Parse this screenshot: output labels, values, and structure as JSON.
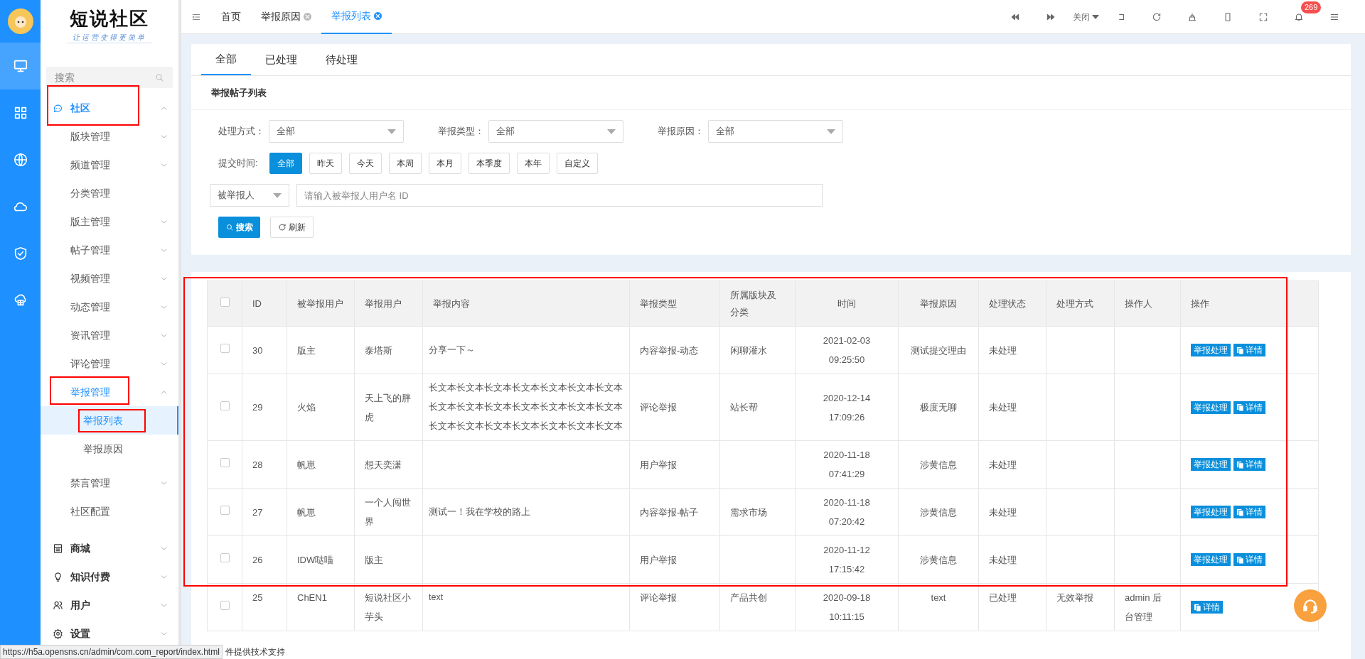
{
  "logo": {
    "title": "短说社区",
    "slogan": "让运营变得更简单"
  },
  "rail": [
    {
      "selected": true
    },
    {
      "selected": false
    },
    {
      "selected": false
    },
    {
      "selected": false
    },
    {
      "selected": false
    },
    {
      "selected": false
    }
  ],
  "sidebar": {
    "search_placeholder": "搜索",
    "items": [
      {
        "label": "社区",
        "expanded": true,
        "children": [
          {
            "label": "版块管理",
            "has_arrow": true
          },
          {
            "label": "频道管理",
            "has_arrow": true
          },
          {
            "label": "分类管理",
            "has_arrow": false
          },
          {
            "label": "版主管理",
            "has_arrow": true
          },
          {
            "label": "帖子管理",
            "has_arrow": true
          },
          {
            "label": "视频管理",
            "has_arrow": true
          },
          {
            "label": "动态管理",
            "has_arrow": true
          },
          {
            "label": "资讯管理",
            "has_arrow": true
          },
          {
            "label": "评论管理",
            "has_arrow": true
          },
          {
            "label": "举报管理",
            "has_arrow": true,
            "expanded": true,
            "children": [
              {
                "label": "举报列表",
                "selected": true
              },
              {
                "label": "举报原因",
                "selected": false
              }
            ]
          },
          {
            "label": "禁言管理",
            "has_arrow": true
          },
          {
            "label": "社区配置",
            "has_arrow": false
          }
        ]
      },
      {
        "label": "商城",
        "expanded": false
      },
      {
        "label": "知识付费",
        "expanded": false
      },
      {
        "label": "用户",
        "expanded": false
      },
      {
        "label": "设置",
        "expanded": false
      }
    ]
  },
  "tabs": [
    {
      "label": "首页",
      "closable": false,
      "selected": false
    },
    {
      "label": "举报原因",
      "closable": true,
      "selected": false
    },
    {
      "label": "举报列表",
      "closable": true,
      "selected": true
    }
  ],
  "toolbar": {
    "close_label": "关闭",
    "notification_count": "269"
  },
  "status_tabs": [
    {
      "label": "全部",
      "selected": true
    },
    {
      "label": "已处理",
      "selected": false
    },
    {
      "label": "待处理",
      "selected": false
    }
  ],
  "section_title": "举报帖子列表",
  "filters": [
    {
      "label": "处理方式：",
      "value": "全部"
    },
    {
      "label": "举报类型：",
      "value": "全部"
    },
    {
      "label": "举报原因：",
      "value": "全部"
    }
  ],
  "time_filter": {
    "label": "提交时间:",
    "options": [
      {
        "label": "全部",
        "selected": true
      },
      {
        "label": "昨天",
        "selected": false
      },
      {
        "label": "今天",
        "selected": false
      },
      {
        "label": "本周",
        "selected": false
      },
      {
        "label": "本月",
        "selected": false
      },
      {
        "label": "本季度",
        "selected": false
      },
      {
        "label": "本年",
        "selected": false
      },
      {
        "label": "自定义",
        "selected": false
      }
    ]
  },
  "user_search": {
    "type": "被举报人",
    "placeholder": "请输入被举报人用户名 ID"
  },
  "buttons": {
    "search": "搜索",
    "refresh": "刷新"
  },
  "table": {
    "all_checked": false,
    "columns": [
      "ID",
      "被举报用户",
      "举报用户",
      "举报内容",
      "举报类型",
      "所属版块及分类",
      "时间",
      "举报原因",
      "处理状态",
      "处理方式",
      "操作人",
      "操作"
    ],
    "rows": [
      {
        "checked": false,
        "cells": [
          "30",
          "版主",
          "泰塔斯",
          "分享一下～",
          "内容举报-动态",
          "闲聊灌水",
          "2021-02-03 09:25:50",
          "测试提交理由",
          "未处理",
          "",
          ""
        ],
        "actions": [
          "举报处理",
          "详情"
        ]
      },
      {
        "checked": false,
        "cells": [
          "29",
          "火焰",
          "天上飞的胖虎",
          "长文本长文本长文本长文本长文本长文本长文本长文本长文本长文本长文本长文本长文本长文本长文本长文本长文本长文本长文本长文本长文本",
          "评论举报",
          "站长帮",
          "2020-12-14 17:09:26",
          "极度无聊",
          "未处理",
          "",
          ""
        ],
        "actions": [
          "举报处理",
          "详情"
        ]
      },
      {
        "checked": false,
        "cells": [
          "28",
          "帆崽",
          "想天奕潇",
          "",
          "用户举报",
          "",
          "2020-11-18 07:41:29",
          "涉黄信息",
          "未处理",
          "",
          ""
        ],
        "actions": [
          "举报处理",
          "详情"
        ]
      },
      {
        "checked": false,
        "cells": [
          "27",
          "帆崽",
          "一个人闯世界",
          "测试一！我在学校的路上",
          "内容举报-帖子",
          "需求市场",
          "2020-11-18 07:20:42",
          "涉黄信息",
          "未处理",
          "",
          ""
        ],
        "actions": [
          "举报处理",
          "详情"
        ]
      },
      {
        "checked": false,
        "cells": [
          "26",
          "IDW哒喵",
          "版主",
          "",
          "用户举报",
          "",
          "2020-11-12 17:15:42",
          "涉黄信息",
          "未处理",
          "",
          ""
        ],
        "actions": [
          "举报处理",
          "详情"
        ]
      },
      {
        "checked": false,
        "cells": [
          "25",
          "ChEN1",
          "短说社区小芋头",
          "text",
          "评论举报",
          "产品共创",
          "2020-09-18 10:11:15",
          "text",
          "已处理",
          "无效举报",
          "admin 后台管理"
        ],
        "actions": [
          "详情"
        ]
      }
    ]
  },
  "status_url": "https://h5a.opensns.cn/admin/com.com_report/index.html",
  "footer": "件提供技术支持"
}
